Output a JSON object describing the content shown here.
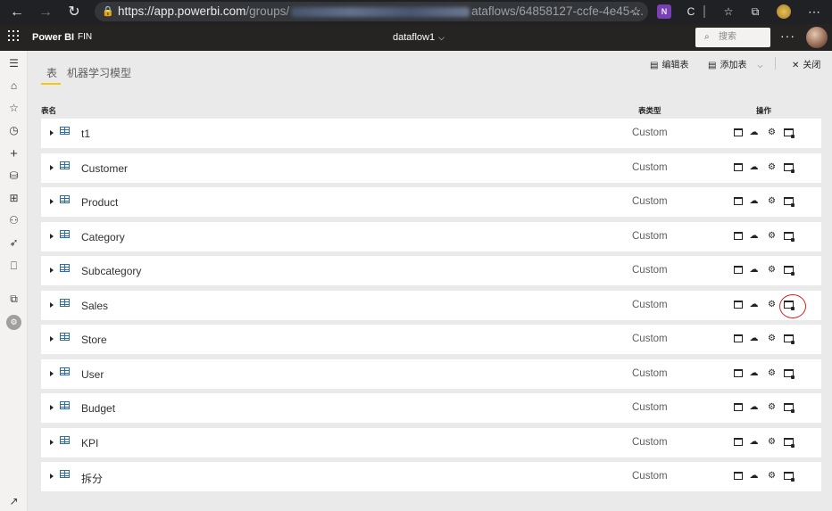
{
  "browser": {
    "url_main": "https://app.powerbi.com",
    "url_path_start": "/groups/",
    "url_path_end": "ataflows/64858127-ccfe-4e45-..."
  },
  "app": {
    "brand": "Power BI",
    "workspace": "FIN",
    "title": "dataflow1",
    "search_placeholder": "搜索",
    "more": "···"
  },
  "tabs": [
    {
      "label": "表"
    },
    {
      "label": "机器学习模型"
    }
  ],
  "toolbar": {
    "edit_tables": "编辑表",
    "add_tables": "添加表",
    "close": "关闭"
  },
  "columns": {
    "name": "表名",
    "type": "表类型",
    "actions": "操作"
  },
  "tables": [
    {
      "name": "t1",
      "type": "Custom"
    },
    {
      "name": "Customer",
      "type": "Custom"
    },
    {
      "name": "Product",
      "type": "Custom"
    },
    {
      "name": "Category",
      "type": "Custom"
    },
    {
      "name": "Subcategory",
      "type": "Custom"
    },
    {
      "name": "Sales",
      "type": "Custom"
    },
    {
      "name": "Store",
      "type": "Custom"
    },
    {
      "name": "User",
      "type": "Custom"
    },
    {
      "name": "Budget",
      "type": "Custom"
    },
    {
      "name": "KPI",
      "type": "Custom"
    },
    {
      "name": "拆分",
      "type": "Custom"
    }
  ],
  "colors": {
    "accent_tab": "#f2c811",
    "highlight": "#d62020",
    "header_bg": "#252423"
  }
}
